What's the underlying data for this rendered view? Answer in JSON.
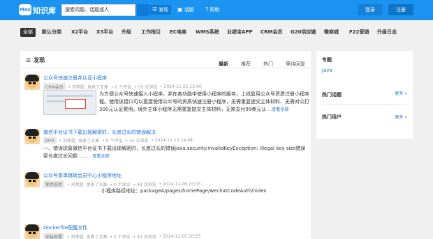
{
  "header": {
    "logo_badge": "Mos",
    "logo_text": "知识库",
    "search_placeholder": "搜索问题、话题或人",
    "nav": [
      {
        "label": "发现",
        "icon": "list-icon"
      },
      {
        "label": "话题",
        "icon": "chat-icon"
      },
      {
        "label": "帮助",
        "icon": "help-icon"
      }
    ],
    "login": "登录",
    "register": "注册"
  },
  "categories": [
    "全部",
    "默认分类",
    "X2平台",
    "X3平台",
    "升级",
    "工作指引",
    "EC电商",
    "WMS系统",
    "业绩宝APP",
    "CRM会员",
    "G20供应链",
    "微商城",
    "F22营销",
    "升级日志"
  ],
  "main": {
    "title": "发现",
    "tabs": [
      "最新",
      "推荐",
      "热门",
      "等待回复"
    ],
    "posts": [
      {
        "title": "公众号快速注册并认证小程序",
        "tag": "CRM会员",
        "author": "• 刘荣超",
        "action": "发表了文章",
        "comments": "• 0 个评论",
        "views": "• 35 次浏览",
        "time": "• 2024-11-22 15:00",
        "body": [
          "为方便公众号快速接入小程序，并在各功能中使用小程序的服务，上线复用公众号资质注册小程序流",
          "程。使用该接口可以直接使用公众号的资质快速注册小程序，无需重复提交主体材料、无需对公打款、无需另付",
          "300元认证费用。境外主体小程序无需重复提交主体材料，无需支付99美元认"
        ],
        "more": "...查看全部"
      },
      {
        "title": "微信平台证书下载出现解密时，长度过长的错误解决",
        "tag": "Java",
        "author": "• 刘荣超",
        "action": "发表了文章",
        "comments": "• 0 个评论",
        "views": "• 34 次浏览",
        "time": "• 2024-11-13 14:48",
        "body": [
          "一、错误现象微信平台证书下载出现解密时，长度过长的错误java.security.InvalidKeyException: Illegal key size错误 分析错误原因：解",
          "密长度过长问题 .....",
          ""
        ],
        "more": "...查看全部"
      },
      {
        "title": "公众号菜单跳转会员中心小程序地址",
        "tag": "使用说明",
        "author": "• 刘荣超",
        "action": "发表了文章",
        "comments": "• 0 个评论",
        "views": "• 44 次浏览",
        "time": "• 2024-11-06 15:03",
        "body": [
          "小程序路径地址：packageA/pages/homePage/wechatCodeAuth/index"
        ],
        "more": ""
      },
      {
        "title": "Dockerfile配置文件",
        "tag": "安装部署",
        "author": "• 刘荣超",
        "action": "发表了文章",
        "comments": "• 0 个评论",
        "views": "• 43 次浏览",
        "time": "• 2024-11-05 10:25",
        "body": [],
        "more": ""
      }
    ]
  },
  "sidebar": {
    "topics_title": "专题",
    "topic_link": "Java",
    "hot_topics_title": "热门话题",
    "hot_topics_more": "更多 »",
    "hot_users_title": "热门用户",
    "hot_users_more": "更多 »"
  }
}
